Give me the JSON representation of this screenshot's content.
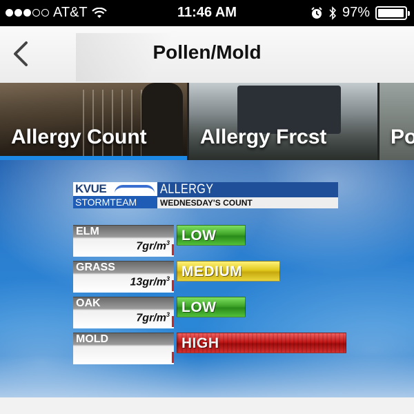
{
  "status_bar": {
    "carrier": "AT&T",
    "signal_bars_filled": 3,
    "signal_bars_total": 5,
    "time": "11:46 AM",
    "battery_percent": "97%",
    "battery_level": 0.97,
    "icons": [
      "wifi-icon",
      "alarm-icon",
      "bluetooth-icon",
      "battery-icon"
    ]
  },
  "nav": {
    "title": "Pollen/Mold",
    "back_icon": "chevron-left-icon"
  },
  "tiles": [
    {
      "label": "Allergy Count",
      "selected": true
    },
    {
      "label": "Allergy Frcst",
      "selected": false
    },
    {
      "label": "Po",
      "selected": false
    }
  ],
  "graphic": {
    "logo_top": "KVUE",
    "logo_bottom": "STORMTEAM",
    "title": "ALLERGY",
    "subtitle": "WEDNESDAY'S COUNT",
    "rows": [
      {
        "name": "ELM",
        "count": "7gr/m",
        "count_sup": "3",
        "level": "LOW",
        "level_class": "low"
      },
      {
        "name": "GRASS",
        "count": "13gr/m",
        "count_sup": "3",
        "level": "MEDIUM",
        "level_class": "medium"
      },
      {
        "name": "OAK",
        "count": "7gr/m",
        "count_sup": "3",
        "level": "LOW",
        "level_class": "low"
      },
      {
        "name": "MOLD",
        "count": "",
        "count_sup": "",
        "level": "HIGH",
        "level_class": "high"
      }
    ]
  },
  "colors": {
    "accent": "#1e88e5",
    "low": "#3fa52a",
    "medium": "#e2c91c",
    "high": "#c41818",
    "sky": "#2b7fd0"
  }
}
